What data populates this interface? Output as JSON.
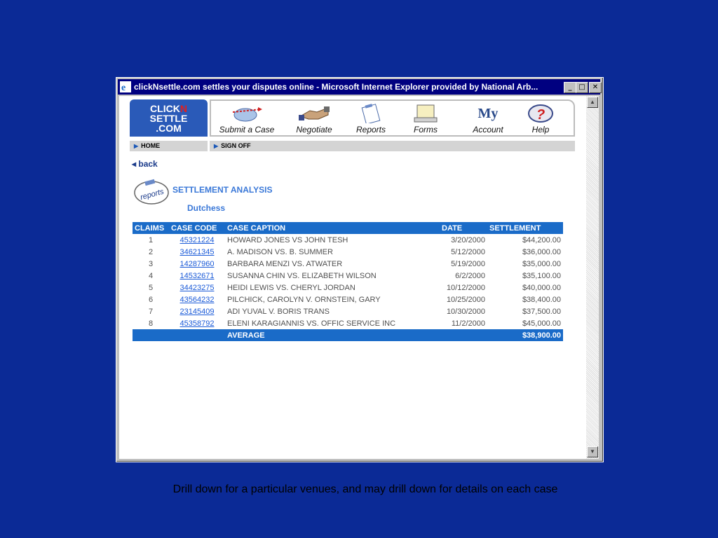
{
  "window": {
    "title": "clickNsettle.com settles your disputes online - Microsoft Internet Explorer provided by National Arb...",
    "minimize": "_",
    "maximize": "□",
    "close": "✕"
  },
  "logo": {
    "line1a": "CLICK",
    "line1b": "N",
    "line2": "SETTLE",
    "line3": ".COM"
  },
  "nav": {
    "submit": "Submit a Case",
    "negotiate": "Negotiate",
    "reports": "Reports",
    "forms": "Forms",
    "account": "Account",
    "account_icon": "My",
    "help": "Help"
  },
  "subnav": {
    "home": "HOME",
    "signoff": "SIGN OFF"
  },
  "back": "◂ back",
  "reports_logo_text": "reports",
  "heading": "SETTLEMENT ANALYSIS",
  "subheading": "Dutchess",
  "table": {
    "headers": [
      "CLAIMS",
      "CASE CODE",
      "CASE CAPTION",
      "DATE",
      "SETTLEMENT"
    ],
    "rows": [
      [
        "1",
        "45321224",
        "HOWARD JONES VS JOHN TESH",
        "3/20/2000",
        "$44,200.00"
      ],
      [
        "2",
        "34621345",
        "A. MADISON VS. B. SUMMER",
        "5/12/2000",
        "$36,000.00"
      ],
      [
        "3",
        "14287960",
        "BARBARA MENZI VS. ATWATER",
        "5/19/2000",
        "$35,000.00"
      ],
      [
        "4",
        "14532671",
        "SUSANNA CHIN VS. ELIZABETH WILSON",
        "6/2/2000",
        "$35,100.00"
      ],
      [
        "5",
        "34423275",
        "HEIDI LEWIS VS. CHERYL JORDAN",
        "10/12/2000",
        "$40,000.00"
      ],
      [
        "6",
        "43564232",
        "PILCHICK, CAROLYN V. ORNSTEIN, GARY",
        "10/25/2000",
        "$38,400.00"
      ],
      [
        "7",
        "23145409",
        "ADI YUVAL V. BORIS TRANS",
        "10/30/2000",
        "$37,500.00"
      ],
      [
        "8",
        "45358792",
        "ELENI KARAGIANNIS VS. OFFIC SERVICE INC",
        "11/2/2000",
        "$45,000.00"
      ]
    ],
    "average_label": "AVERAGE",
    "average_value": "$38,900.00"
  },
  "caption": "Drill down for a particular venues, and may drill down for details on each case",
  "colors": {
    "background": "#0b2a96",
    "accent": "#1a6bc8",
    "link": "#1a5ad8"
  }
}
